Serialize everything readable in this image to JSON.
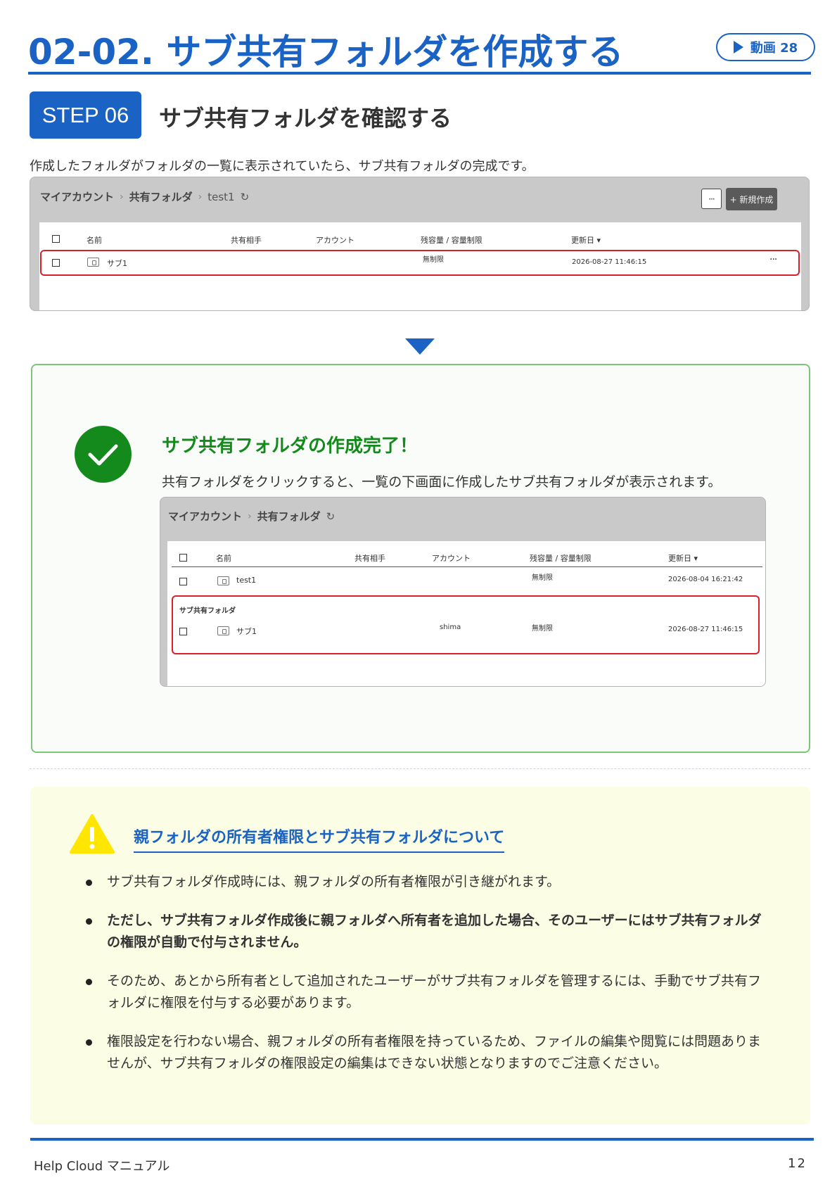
{
  "header": {
    "title": "02-02. サブ共有フォルダを作成する",
    "video_label": "動画 28"
  },
  "step": {
    "badge": "STEP 06",
    "title": "サブ共有フォルダを確認する",
    "intro": "作成したフォルダがフォルダの一覧に表示されていたら、サブ共有フォルダの完成です。"
  },
  "screenshot1": {
    "crumb": [
      "マイアカウント",
      "共有フォルダ",
      "test1"
    ],
    "more_label": "···",
    "new_label": "+ 新規作成",
    "columns": [
      "名前",
      "共有相手",
      "アカウント",
      "残容量 / 容量制限",
      "更新日 ▾"
    ],
    "row": {
      "name": "サブ1",
      "capacity": "無制限",
      "updated": "2026-08-27 11:46:15",
      "menu": "···"
    }
  },
  "result": {
    "title": "サブ共有フォルダの作成完了！",
    "desc": "共有フォルダをクリックすると、一覧の下画面に作成したサブ共有フォルダが表示されます。"
  },
  "screenshot2": {
    "crumb": [
      "マイアカウント",
      "共有フォルダ"
    ],
    "columns": [
      "名前",
      "共有相手",
      "アカウント",
      "残容量 / 容量制限",
      "更新日 ▾"
    ],
    "row1": {
      "name": "test1",
      "capacity": "無制限",
      "updated": "2026-08-04 16:21:42"
    },
    "section_label": "サブ共有フォルダ",
    "row2": {
      "name": "サブ1",
      "account": "shima",
      "capacity": "無制限",
      "updated": "2026-08-27 11:46:15"
    }
  },
  "note": {
    "title": "親フォルダの所有者権限とサブ共有フォルダについて",
    "items": [
      "サブ共有フォルダ作成時には、親フォルダの所有者権限が引き継がれます。",
      "ただし、サブ共有フォルダ作成後に親フォルダへ所有者を追加した場合、そのユーザーにはサブ共有フォルダの権限が自動で付与されません。",
      "そのため、あとから所有者として追加されたユーザーがサブ共有フォルダを管理するには、手動でサブ共有フォルダに権限を付与する必要があります。",
      "権限設定を行わない場合、親フォルダの所有者権限を持っているため、ファイルの編集や閲覧には問題ありませんが、サブ共有フォルダの権限設定の編集はできない状態となりますのでご注意ください。"
    ]
  },
  "footer": {
    "left": "Help Cloud マニュアル",
    "page": "12"
  },
  "colors": {
    "accent": "#1a63c4",
    "success": "#148a1c",
    "highlight": "#d8202d",
    "note_bg": "#fbfde4"
  }
}
